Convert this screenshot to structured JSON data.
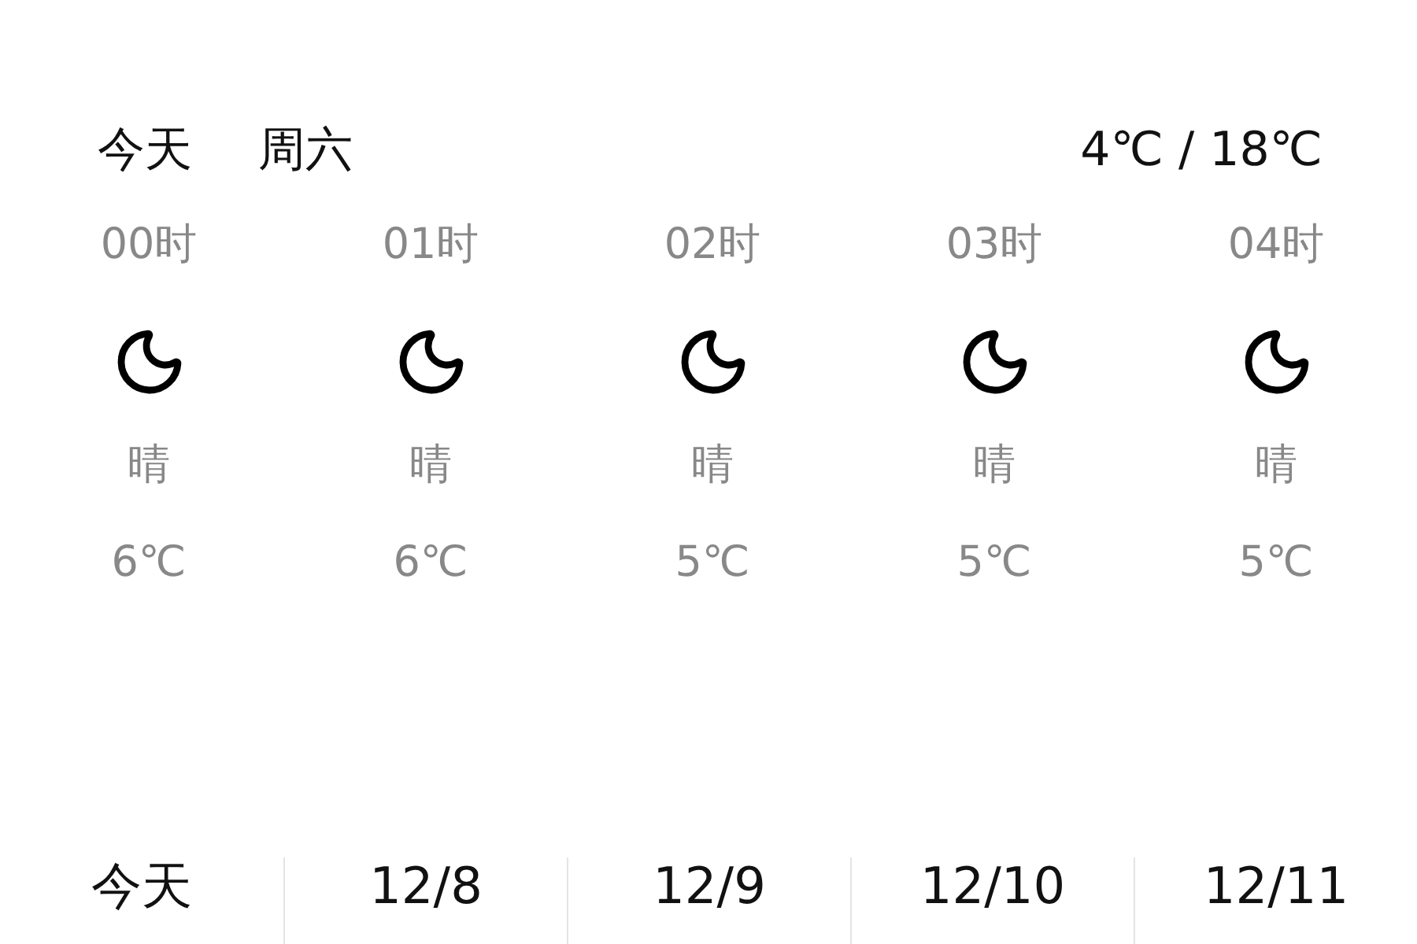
{
  "header": {
    "day": "今天",
    "weekday": "周六",
    "range": "4℃ / 18℃"
  },
  "hours": [
    {
      "time": "00时",
      "condition": "晴",
      "temp": "6℃"
    },
    {
      "time": "01时",
      "condition": "晴",
      "temp": "6℃"
    },
    {
      "time": "02时",
      "condition": "晴",
      "temp": "5℃"
    },
    {
      "time": "03时",
      "condition": "晴",
      "temp": "5℃"
    },
    {
      "time": "04时",
      "condition": "晴",
      "temp": "5℃"
    }
  ],
  "days": [
    {
      "label": "今天"
    },
    {
      "label": "12/8"
    },
    {
      "label": "12/9"
    },
    {
      "label": "12/10"
    },
    {
      "label": "12/11"
    }
  ]
}
